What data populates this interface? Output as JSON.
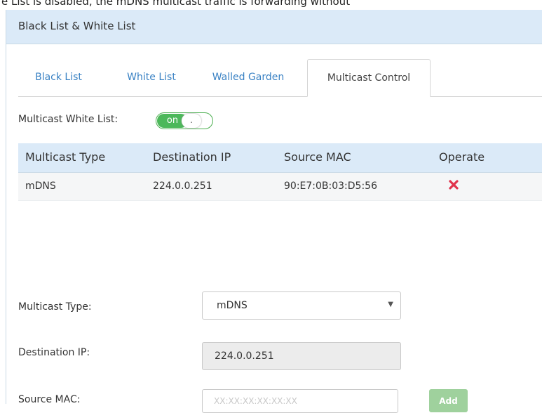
{
  "top_text": "e List is disabled, the mDNS multicast traffic is forwarding without",
  "panel": {
    "title": "Black List & White List"
  },
  "tabs": [
    {
      "label": "Black List"
    },
    {
      "label": "White List"
    },
    {
      "label": "Walled Garden"
    },
    {
      "label": "Multicast Control",
      "active": true
    }
  ],
  "multicast_whitelist": {
    "label": "Multicast White List:",
    "toggle_on": "on",
    "toggle_knob": "."
  },
  "table": {
    "headers": [
      "Multicast Type",
      "Destination IP",
      "Source MAC",
      "Operate"
    ],
    "rows": [
      {
        "type": "mDNS",
        "dest_ip": "224.0.0.251",
        "source_mac": "90:E7:0B:03:D5:56",
        "operate_icon": "delete-x-icon"
      }
    ]
  },
  "form": {
    "type_label": "Multicast Type:",
    "type_value": "mDNS",
    "dest_label": "Destination IP:",
    "dest_value": "224.0.0.251",
    "mac_label": "Source MAC:",
    "mac_placeholder": "XX:XX:XX:XX:XX:XX",
    "add_label": "Add"
  },
  "colors": {
    "header_bg": "#dbeaf8",
    "tab_link": "#3a82c4",
    "toggle_on": "#4cb85a",
    "delete_icon": "#e0334b",
    "add_button": "#9fd19d"
  }
}
